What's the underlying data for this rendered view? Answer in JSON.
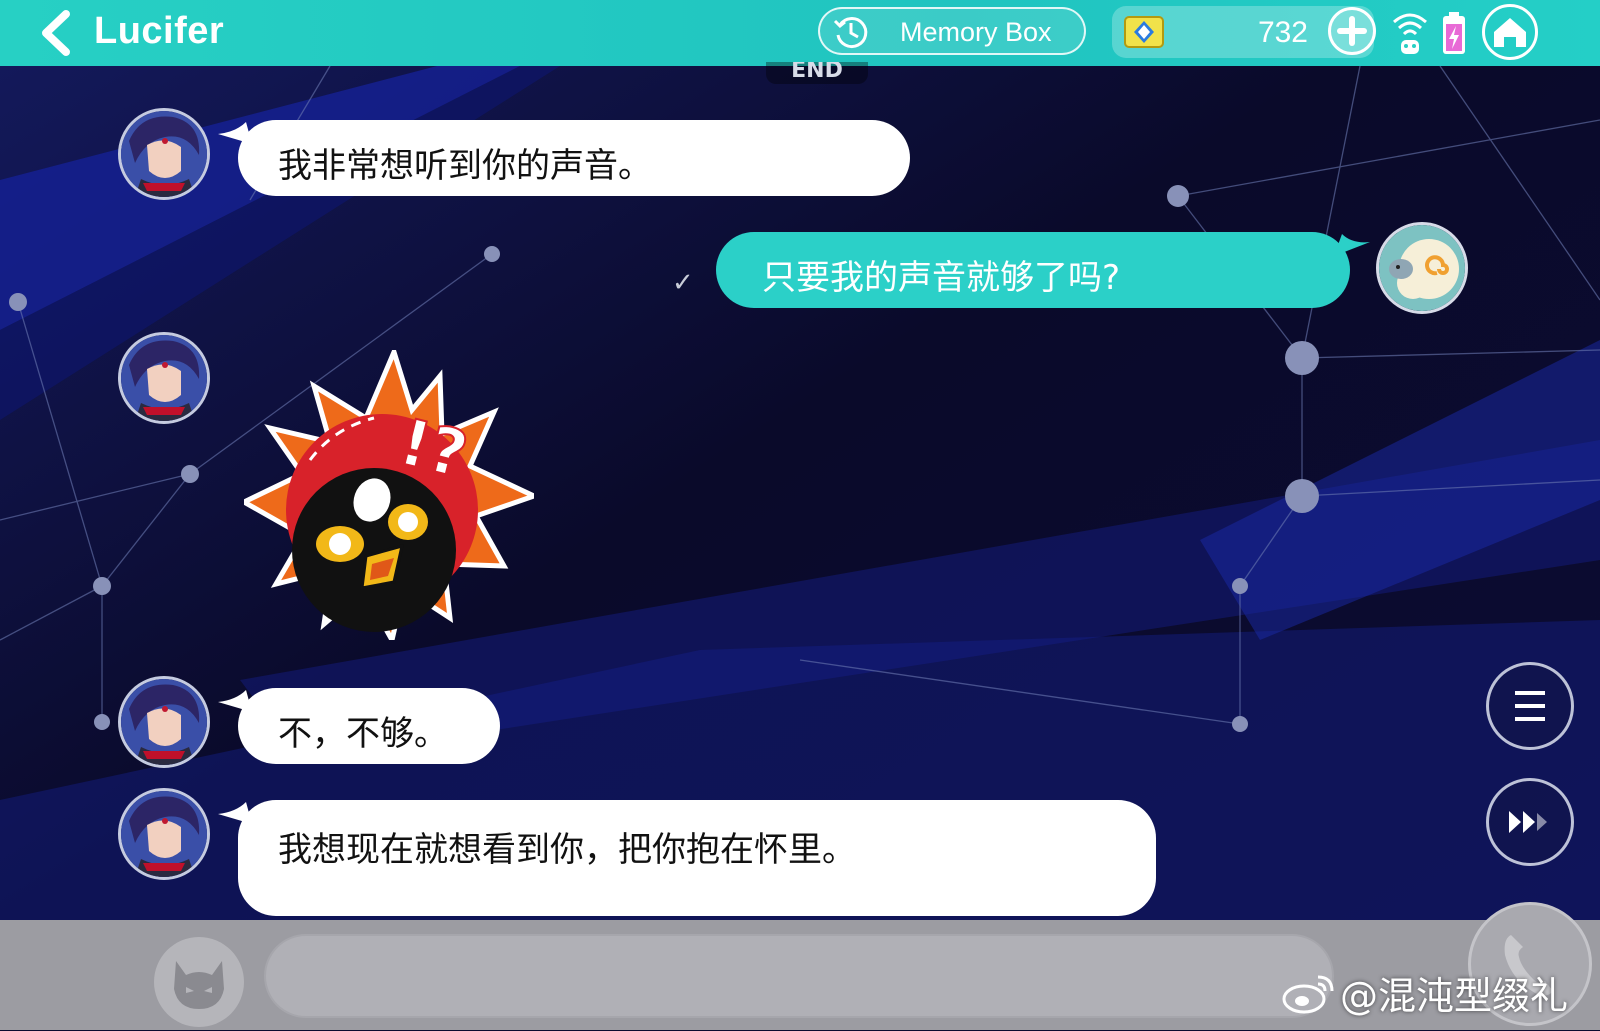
{
  "header": {
    "title": "Lucifer",
    "memory_box_label": "Memory Box",
    "currency_value": "732"
  },
  "chat": {
    "end_tag": "END",
    "messages": [
      {
        "sender": "Lucifer",
        "text": "我非常想听到你的声音。"
      },
      {
        "sender": "me",
        "text": "只要我的声音就够了吗?",
        "read_mark": "✓"
      },
      {
        "sender": "Lucifer",
        "sticker": "surprised-bird-sticker"
      },
      {
        "sender": "Lucifer",
        "text": "不，不够。"
      },
      {
        "sender": "Lucifer",
        "text": "我想现在就想看到你，把你抱在怀里。"
      }
    ]
  },
  "sticker_text": "!?",
  "watermark": "@混沌型缀礼",
  "colors": {
    "accent": "#27d0c4",
    "my_bubble": "#2bd0c8",
    "other_bubble": "#ffffff",
    "background": "#0b0b30",
    "bottom_bar": "#9c9ca2"
  },
  "icons": [
    "back-chevron-icon",
    "history-clock-icon",
    "gem-icon",
    "plus-icon",
    "wifi-icon",
    "battery-icon",
    "home-icon",
    "menu-icon",
    "fast-forward-icon",
    "devil-emoji-icon",
    "phone-icon",
    "weibo-icon"
  ]
}
